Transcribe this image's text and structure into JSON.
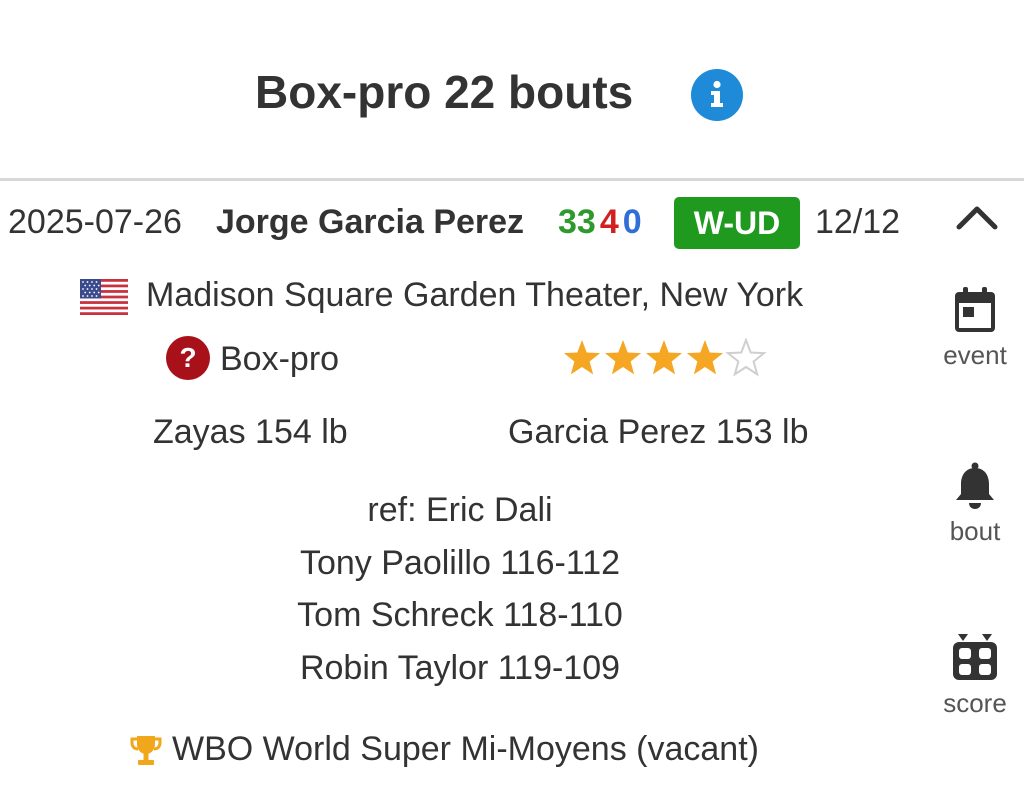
{
  "header": {
    "title": "Box-pro 22 bouts",
    "info_icon": "info-icon"
  },
  "bout": {
    "date": "2025-07-26",
    "opponent": "Jorge Garcia Perez",
    "record": {
      "wins": "33",
      "losses": "4",
      "draws": "0"
    },
    "result": "W-UD",
    "rounds": "12/12",
    "venue": "Madison Square Garden Theater, New York",
    "sanction": "Box-pro",
    "rating_stars": 4,
    "rating_max": 5,
    "weights": {
      "fighter": "Zayas 154 lb",
      "opponent": "Garcia Perez 153 lb"
    },
    "officials": {
      "referee": "ref: Eric Dali",
      "judges": [
        "Tony Paolillo 116-112",
        "Tom Schreck 118-110",
        "Robin Taylor 119-109"
      ]
    },
    "title_fight": "WBO World Super Mi-Moyens (vacant)"
  },
  "side_actions": {
    "event_label": "event",
    "bout_label": "bout",
    "score_label": "score"
  },
  "colors": {
    "win": "#2e9a2e",
    "loss": "#d21f1f",
    "draw": "#2f6fd6",
    "badge": "#1f9a1f",
    "info": "#1f8ad8",
    "star": "#f5a623",
    "sanction_icon": "#a8101a"
  }
}
